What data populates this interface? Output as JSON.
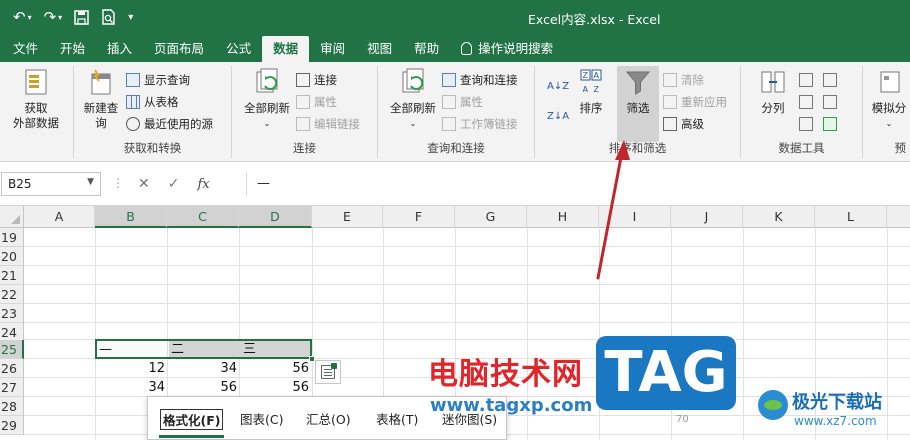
{
  "window": {
    "title": "Excel内容.xlsx  -  Excel"
  },
  "qat": {
    "undo_icon": "undo-icon",
    "redo_icon": "redo-icon",
    "save_icon": "save-icon",
    "preview_icon": "print-preview-icon"
  },
  "tabs": [
    {
      "label": "文件"
    },
    {
      "label": "开始"
    },
    {
      "label": "插入"
    },
    {
      "label": "页面布局"
    },
    {
      "label": "公式"
    },
    {
      "label": "数据"
    },
    {
      "label": "审阅"
    },
    {
      "label": "视图"
    },
    {
      "label": "帮助"
    },
    {
      "label": "操作说明搜索"
    }
  ],
  "ribbon": {
    "get_data": {
      "line1": "获取",
      "line2": "外部数据"
    },
    "new_query": {
      "line1": "新建查",
      "line2": "询"
    },
    "show_queries": "显示查询",
    "from_table": "从表格",
    "recent_sources": "最近使用的源",
    "group_get_transform": "获取和转换",
    "refresh_all_1": "全部刷新",
    "connections": "连接",
    "properties_1": "属性",
    "edit_links": "编辑链接",
    "group_connections": "连接",
    "refresh_all_2": "全部刷新",
    "queries_connections": "查询和连接",
    "properties_2": "属性",
    "workbook_links": "工作簿链接",
    "group_queries": "查询和连接",
    "sort": "排序",
    "filter": "筛选",
    "clear": "清除",
    "reapply": "重新应用",
    "advanced": "高级",
    "group_sort_filter": "排序和筛选",
    "split": "分列",
    "group_data_tools": "数据工具",
    "whatif": "模拟分",
    "group_forecast_partial": "预"
  },
  "formula_bar": {
    "name_box": "B25",
    "dots": "⋮",
    "cancel": "✕",
    "enter": "✓",
    "fx": "fx",
    "content": "—"
  },
  "grid": {
    "columns": [
      "A",
      "B",
      "C",
      "D",
      "E",
      "F",
      "G",
      "H",
      "I",
      "J",
      "K",
      "L"
    ],
    "rows": [
      "19",
      "20",
      "21",
      "22",
      "23",
      "24",
      "25",
      "26",
      "27",
      "28",
      "29"
    ],
    "cells": {
      "B25": "—",
      "C25": "二",
      "D25": "三",
      "B26": "12",
      "C26": "34",
      "D26": "56",
      "B27": "34",
      "C27": "56",
      "D27": "56"
    }
  },
  "quick_analysis": {
    "tabs": [
      {
        "label": "格式化(F)"
      },
      {
        "label": "图表(C)"
      },
      {
        "label": "汇总(O)"
      },
      {
        "label": "表格(T)"
      },
      {
        "label": "迷你图(S)"
      }
    ]
  },
  "watermarks": {
    "cn": "电脑技术网",
    "url": "www.tagxp.com",
    "tag": "TAG",
    "aurora_name": "极光下载站",
    "aurora_url": "www.xz7.com",
    "faint_number": "70"
  },
  "colors": {
    "excel_green": "#217346",
    "annotation_arrow": "#c0262b"
  }
}
